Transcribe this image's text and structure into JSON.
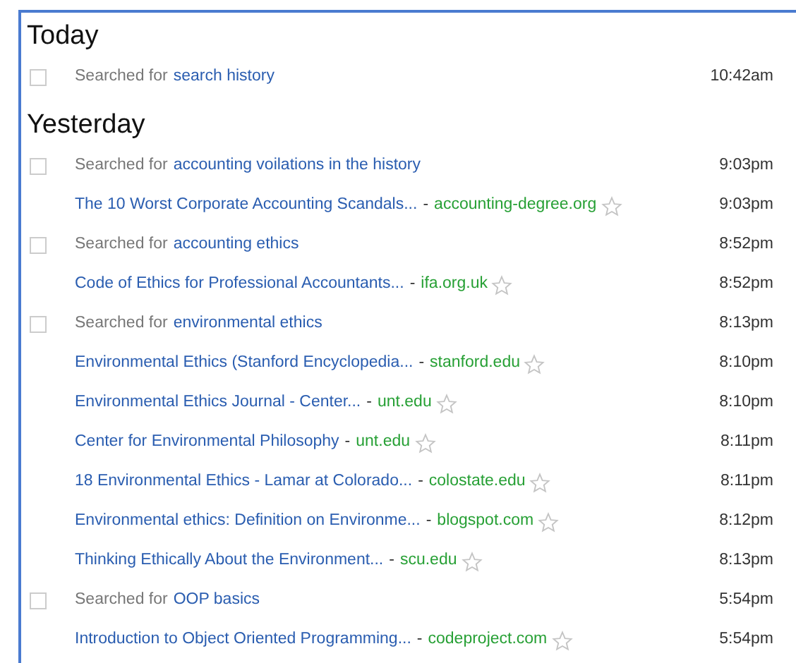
{
  "sections": [
    {
      "heading": "Today",
      "items": [
        {
          "kind": "search",
          "prefix": "Searched for",
          "query": "search history",
          "checked": false,
          "time": "10:42am"
        }
      ]
    },
    {
      "heading": "Yesterday",
      "items": [
        {
          "kind": "search",
          "prefix": "Searched for",
          "query": "accounting voilations in the history",
          "checked": false,
          "time": "9:03pm"
        },
        {
          "kind": "page",
          "title": "The 10 Worst Corporate Accounting Scandals...",
          "separator": "-",
          "domain": "accounting-degree.org",
          "starred": false,
          "time": "9:03pm"
        },
        {
          "kind": "search",
          "prefix": "Searched for",
          "query": "accounting ethics",
          "checked": false,
          "time": "8:52pm"
        },
        {
          "kind": "page",
          "title": "Code of Ethics for Professional Accountants...",
          "separator": "-",
          "domain": "ifa.org.uk",
          "starred": false,
          "time": "8:52pm"
        },
        {
          "kind": "search",
          "prefix": "Searched for",
          "query": "environmental ethics",
          "checked": false,
          "time": "8:13pm"
        },
        {
          "kind": "page",
          "title": "Environmental Ethics (Stanford Encyclopedia...",
          "separator": "-",
          "domain": "stanford.edu",
          "starred": false,
          "time": "8:10pm"
        },
        {
          "kind": "page",
          "title": "Environmental Ethics Journal - Center...",
          "separator": "-",
          "domain": "unt.edu",
          "starred": false,
          "time": "8:10pm"
        },
        {
          "kind": "page",
          "title": "Center for Environmental Philosophy",
          "separator": "-",
          "domain": "unt.edu",
          "starred": false,
          "time": "8:11pm"
        },
        {
          "kind": "page",
          "title": "18 Environmental Ethics - Lamar at Colorado...",
          "separator": "-",
          "domain": "colostate.edu",
          "starred": false,
          "time": "8:11pm"
        },
        {
          "kind": "page",
          "title": "Environmental ethics: Definition on Environme...",
          "separator": "-",
          "domain": "blogspot.com",
          "starred": false,
          "time": "8:12pm"
        },
        {
          "kind": "page",
          "title": "Thinking Ethically About the Environment...",
          "separator": "-",
          "domain": "scu.edu",
          "starred": false,
          "time": "8:13pm"
        },
        {
          "kind": "search",
          "prefix": "Searched for",
          "query": "OOP basics",
          "checked": false,
          "time": "5:54pm"
        },
        {
          "kind": "page",
          "title": "Introduction to Object Oriented Programming...",
          "separator": "-",
          "domain": "codeproject.com",
          "starred": false,
          "time": "5:54pm"
        }
      ]
    }
  ]
}
